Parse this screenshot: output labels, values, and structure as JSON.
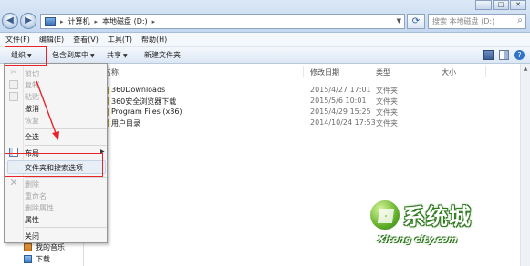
{
  "window": {
    "buttons": [
      "–",
      "□",
      "✕"
    ]
  },
  "addressbar": {
    "crumbs": [
      "计算机",
      "本地磁盘 (D:)"
    ],
    "search_placeholder": "搜索 本地磁盘 (D:)"
  },
  "menubar": {
    "items": [
      "文件(F)",
      "编辑(E)",
      "查看(V)",
      "工具(T)",
      "帮助(H)"
    ]
  },
  "toolbar": {
    "organize": "组织",
    "include_in_library": "包含到库中",
    "share": "共享",
    "new_folder": "新建文件夹"
  },
  "columns": {
    "name": "名称",
    "date": "修改日期",
    "type": "类型",
    "size": "大小"
  },
  "files": [
    {
      "name": "360Downloads",
      "date": "2015/4/27 17:01",
      "type": "文件夹"
    },
    {
      "name": "360安全浏览器下载",
      "date": "2015/5/6 10:01",
      "type": "文件夹"
    },
    {
      "name": "Program Files (x86)",
      "date": "2015/4/29 15:25",
      "type": "文件夹"
    },
    {
      "name": "用户目录",
      "date": "2014/10/24 17:53",
      "type": "文件夹"
    }
  ],
  "dropdown": {
    "cut": "剪切",
    "copy": "复制",
    "paste": "粘贴",
    "undo": "撤消",
    "redo": "恢复",
    "select_all": "全选",
    "layout": "布局",
    "folder_options": "文件夹和搜索选项",
    "delete": "删除",
    "rename": "重命名",
    "remove_properties": "删除属性",
    "properties": "属性",
    "close": "关闭"
  },
  "navpane": {
    "items": [
      "我的音乐",
      "下载"
    ]
  },
  "watermark": {
    "title": "系统城",
    "subtitle": "Xitong city.com"
  },
  "colors": {
    "annotation_red": "#e8242a",
    "titlebar": "#c4d8ef",
    "watermark_green": "#2e7a1e"
  }
}
